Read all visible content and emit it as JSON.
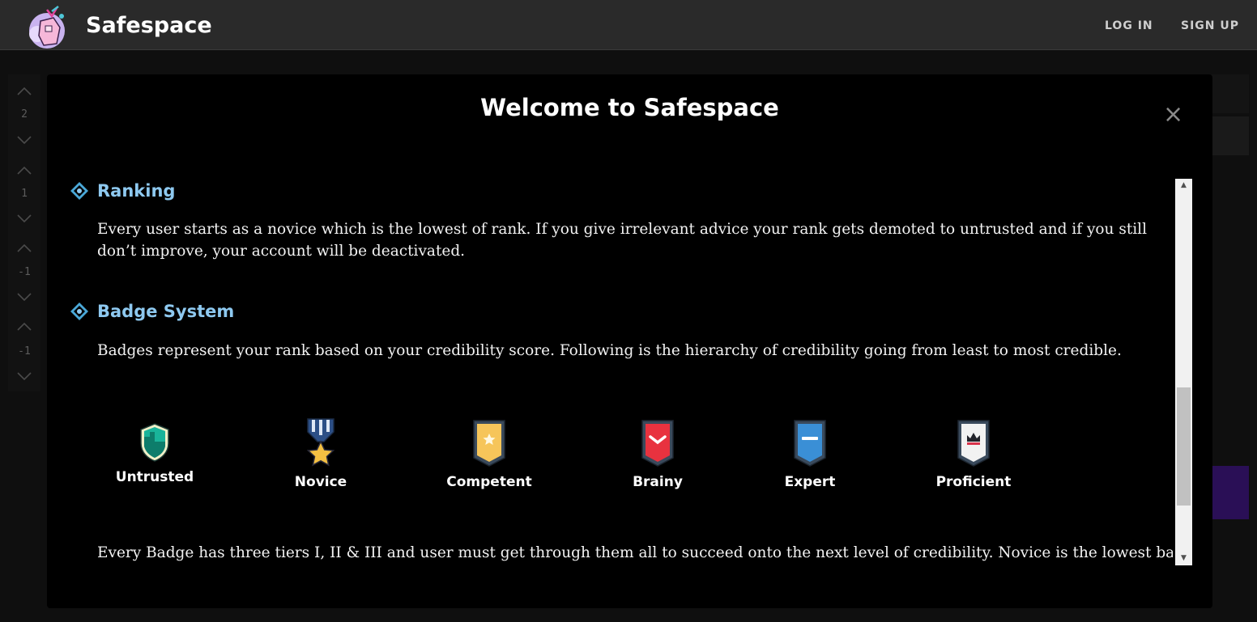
{
  "app": {
    "name": "Safespace",
    "nav": {
      "login": "LOG IN",
      "signup": "SIGN UP"
    }
  },
  "votes": [
    "2",
    "1",
    "-1",
    "-1"
  ],
  "modal": {
    "title": "Welcome to Safespace",
    "close": "×",
    "sections": [
      {
        "heading": "Ranking",
        "text": "Every user starts as a novice which is the lowest of rank. If you give irrelevant advice your rank gets demoted to untrusted and if you still don’t improve, your account will be deactivated."
      },
      {
        "heading": "Badge System",
        "text": "Badges represent your rank based on your credibility score. Following is the hierarchy of credibility going from least to most credible."
      }
    ],
    "badges": [
      {
        "label": "Untrusted",
        "icon": "untrusted-shield-icon"
      },
      {
        "label": "Novice",
        "icon": "novice-medal-icon"
      },
      {
        "label": "Competent",
        "icon": "competent-banner-icon"
      },
      {
        "label": "Brainy",
        "icon": "brainy-banner-icon"
      },
      {
        "label": "Expert",
        "icon": "expert-banner-icon"
      },
      {
        "label": "Proficient",
        "icon": "proficient-banner-icon"
      }
    ],
    "footer_text": "Every Badge has three tiers I, II & III and user must get through them all to succeed onto the next level of credibility. Novice is the lowest badge"
  },
  "colors": {
    "heading": "#8ec9f0",
    "navbar": "#2a2a2a",
    "modal_bg": "#000000"
  }
}
